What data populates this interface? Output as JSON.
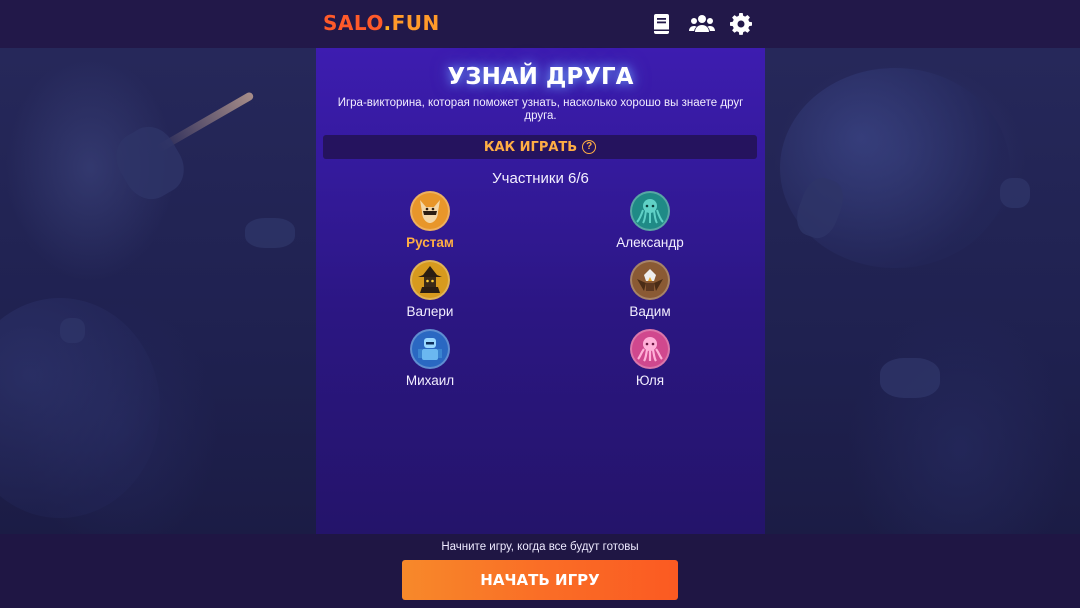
{
  "header": {
    "logo_part1": "SALO",
    "logo_dot": ".",
    "logo_part2": "FUN",
    "icons": [
      "book-icon",
      "users-icon",
      "gear-icon"
    ]
  },
  "main": {
    "title": "УЗНАЙ ДРУГА",
    "subtitle": "Игра-викторина, которая поможет узнать, насколько хорошо вы знаете друг друга.",
    "how_to_play": "КАК ИГРАТЬ",
    "participants_label": "Участники 6/6",
    "players": [
      {
        "name": "Рустам",
        "avatar": "fox-avatar",
        "color": "#e8962a",
        "is_me": true
      },
      {
        "name": "Александр",
        "avatar": "cthulhu-avatar",
        "color": "#1f8a86",
        "is_me": false
      },
      {
        "name": "Валери",
        "avatar": "witch-avatar",
        "color": "#d79a1e",
        "is_me": false
      },
      {
        "name": "Вадим",
        "avatar": "eagle-avatar",
        "color": "#8a5a34",
        "is_me": false
      },
      {
        "name": "Михаил",
        "avatar": "robot-avatar",
        "color": "#2a68c2",
        "is_me": false
      },
      {
        "name": "Юля",
        "avatar": "octopus-avatar",
        "color": "#d0488e",
        "is_me": false
      }
    ]
  },
  "footer": {
    "hint": "Начните игру, когда все будут готовы",
    "start_button": "НАЧАТЬ ИГРУ"
  },
  "colors": {
    "accent_orange": "#ffae44",
    "button_gradient_start": "#f7892a",
    "button_gradient_end": "#fb5a22",
    "panel_top": "#3d1cb0"
  }
}
